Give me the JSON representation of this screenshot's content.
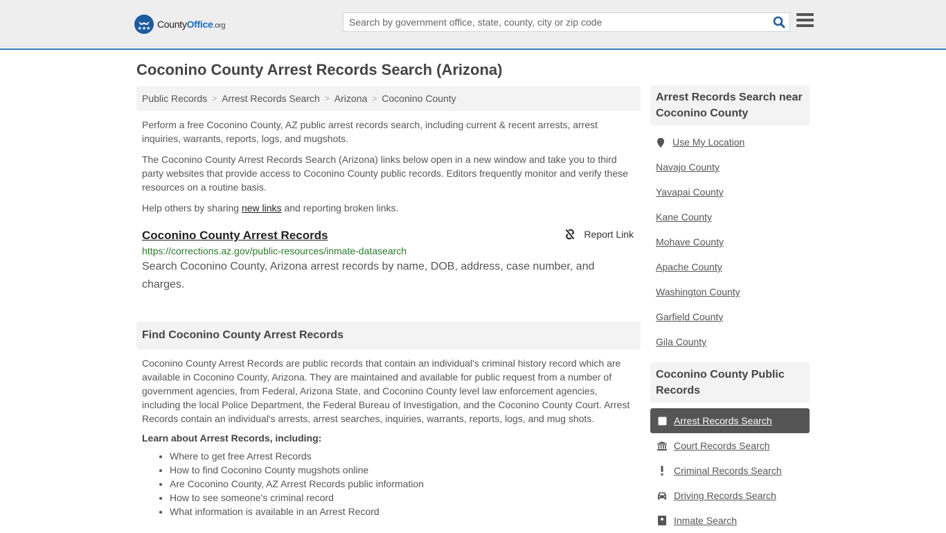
{
  "header": {
    "logo_text_county": "County",
    "logo_text_office": "Office",
    "logo_text_org": ".org",
    "search_placeholder": "Search by government office, state, county, city or zip code",
    "search_value": "",
    "search_icon": "search-icon",
    "menu_icon": "hamburger-menu-icon",
    "accent_color": "#337ab7"
  },
  "page": {
    "title": "Coconino County Arrest Records Search (Arizona)"
  },
  "breadcrumb": [
    {
      "label": "Public Records"
    },
    {
      "label": "Arrest Records Search"
    },
    {
      "label": "Arizona"
    },
    {
      "label": "Coconino County"
    }
  ],
  "intro": {
    "p1": "Perform a free Coconino County, AZ public arrest records search, including current & recent arrests, arrest inquiries, warrants, reports, logs, and mugshots.",
    "p2": "The Coconino County Arrest Records Search (Arizona) links below open in a new window and take you to third party websites that provide access to Coconino County public records. Editors frequently monitor and verify these resources on a routine basis.",
    "p3_before": "Help others by sharing ",
    "p3_link": "new links",
    "p3_after": " and reporting broken links."
  },
  "link_entry": {
    "title": "Coconino County Arrest Records",
    "report_label": "Report Link",
    "report_icon": "broken-link-icon",
    "url": "https://corrections.az.gov/public-resources/inmate-datasearch",
    "description": "Search Coconino County, Arizona arrest records by name, DOB, address, case number, and charges."
  },
  "find_section": {
    "heading": "Find Coconino County Arrest Records",
    "body": "Coconino County Arrest Records are public records that contain an individual's criminal history record which are available in Coconino County, Arizona. They are maintained and available for public request from a number of government agencies, from Federal, Arizona State, and Coconino County level law enforcement agencies, including the local Police Department, the Federal Bureau of Investigation, and the Coconino County Court. Arrest Records contain an individual's arrests, arrest searches, inquiries, warrants, reports, logs, and mug shots.",
    "learn_heading": "Learn about Arrest Records, including:",
    "learn_items": [
      "Where to get free Arrest Records",
      "How to find Coconino County mugshots online",
      "Are Coconino County, AZ Arrest Records public information",
      "How to see someone's criminal record",
      "What information is available in an Arrest Record"
    ]
  },
  "sidebar": {
    "near_heading": "Arrest Records Search near Coconino County",
    "use_location": "Use My Location",
    "near_counties": [
      "Navajo County",
      "Yavapai County",
      "Kane County",
      "Mohave County",
      "Apache County",
      "Washington County",
      "Garfield County",
      "Gila County"
    ],
    "records_heading": "Coconino County Public Records",
    "records": [
      {
        "label": "Arrest Records Search",
        "icon": "square-icon",
        "active": true
      },
      {
        "label": "Court Records Search",
        "icon": "courthouse-icon",
        "active": false
      },
      {
        "label": "Criminal Records Search",
        "icon": "exclamation-icon",
        "active": false
      },
      {
        "label": "Driving Records Search",
        "icon": "car-icon",
        "active": false
      },
      {
        "label": "Inmate Search",
        "icon": "inmate-icon",
        "active": false
      }
    ]
  }
}
